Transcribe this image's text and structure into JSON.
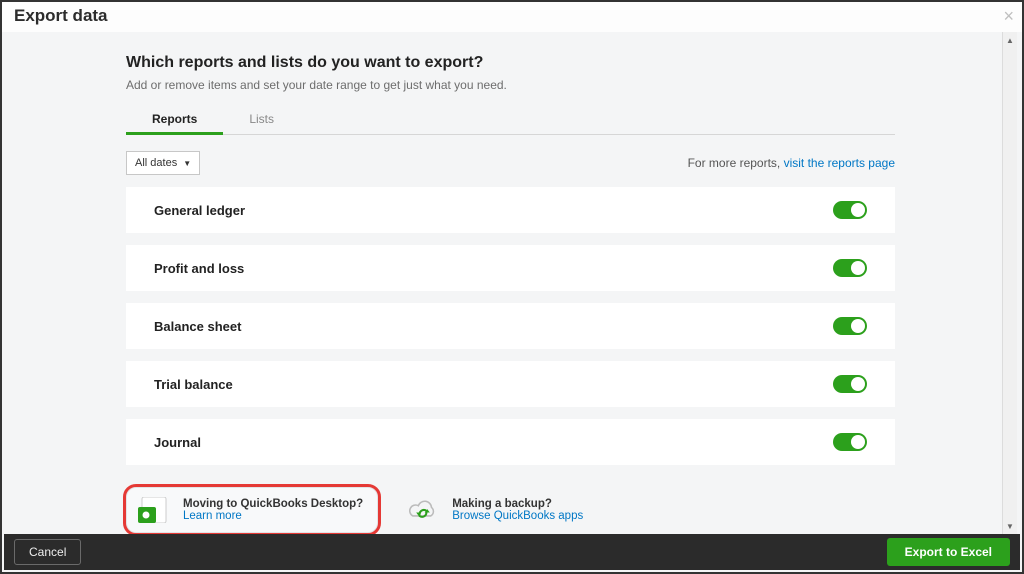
{
  "window": {
    "title": "Export data"
  },
  "heading": "Which reports and lists do you want to export?",
  "subheading": "Add or remove items and set your date range to get just what you need.",
  "tabs": {
    "reports": "Reports",
    "lists": "Lists",
    "active": "reports"
  },
  "date_filter": "All dates",
  "more_reports": {
    "prefix": "For more reports, ",
    "link": "visit the reports page"
  },
  "reports": [
    {
      "label": "General ledger",
      "enabled": true
    },
    {
      "label": "Profit and loss",
      "enabled": true
    },
    {
      "label": "Balance sheet",
      "enabled": true
    },
    {
      "label": "Trial balance",
      "enabled": true
    },
    {
      "label": "Journal",
      "enabled": true
    }
  ],
  "promos": {
    "desktop": {
      "title": "Moving to QuickBooks Desktop?",
      "link": "Learn more"
    },
    "backup": {
      "title": "Making a backup?",
      "link": "Browse QuickBooks apps"
    }
  },
  "footer": {
    "cancel": "Cancel",
    "export": "Export to Excel"
  }
}
